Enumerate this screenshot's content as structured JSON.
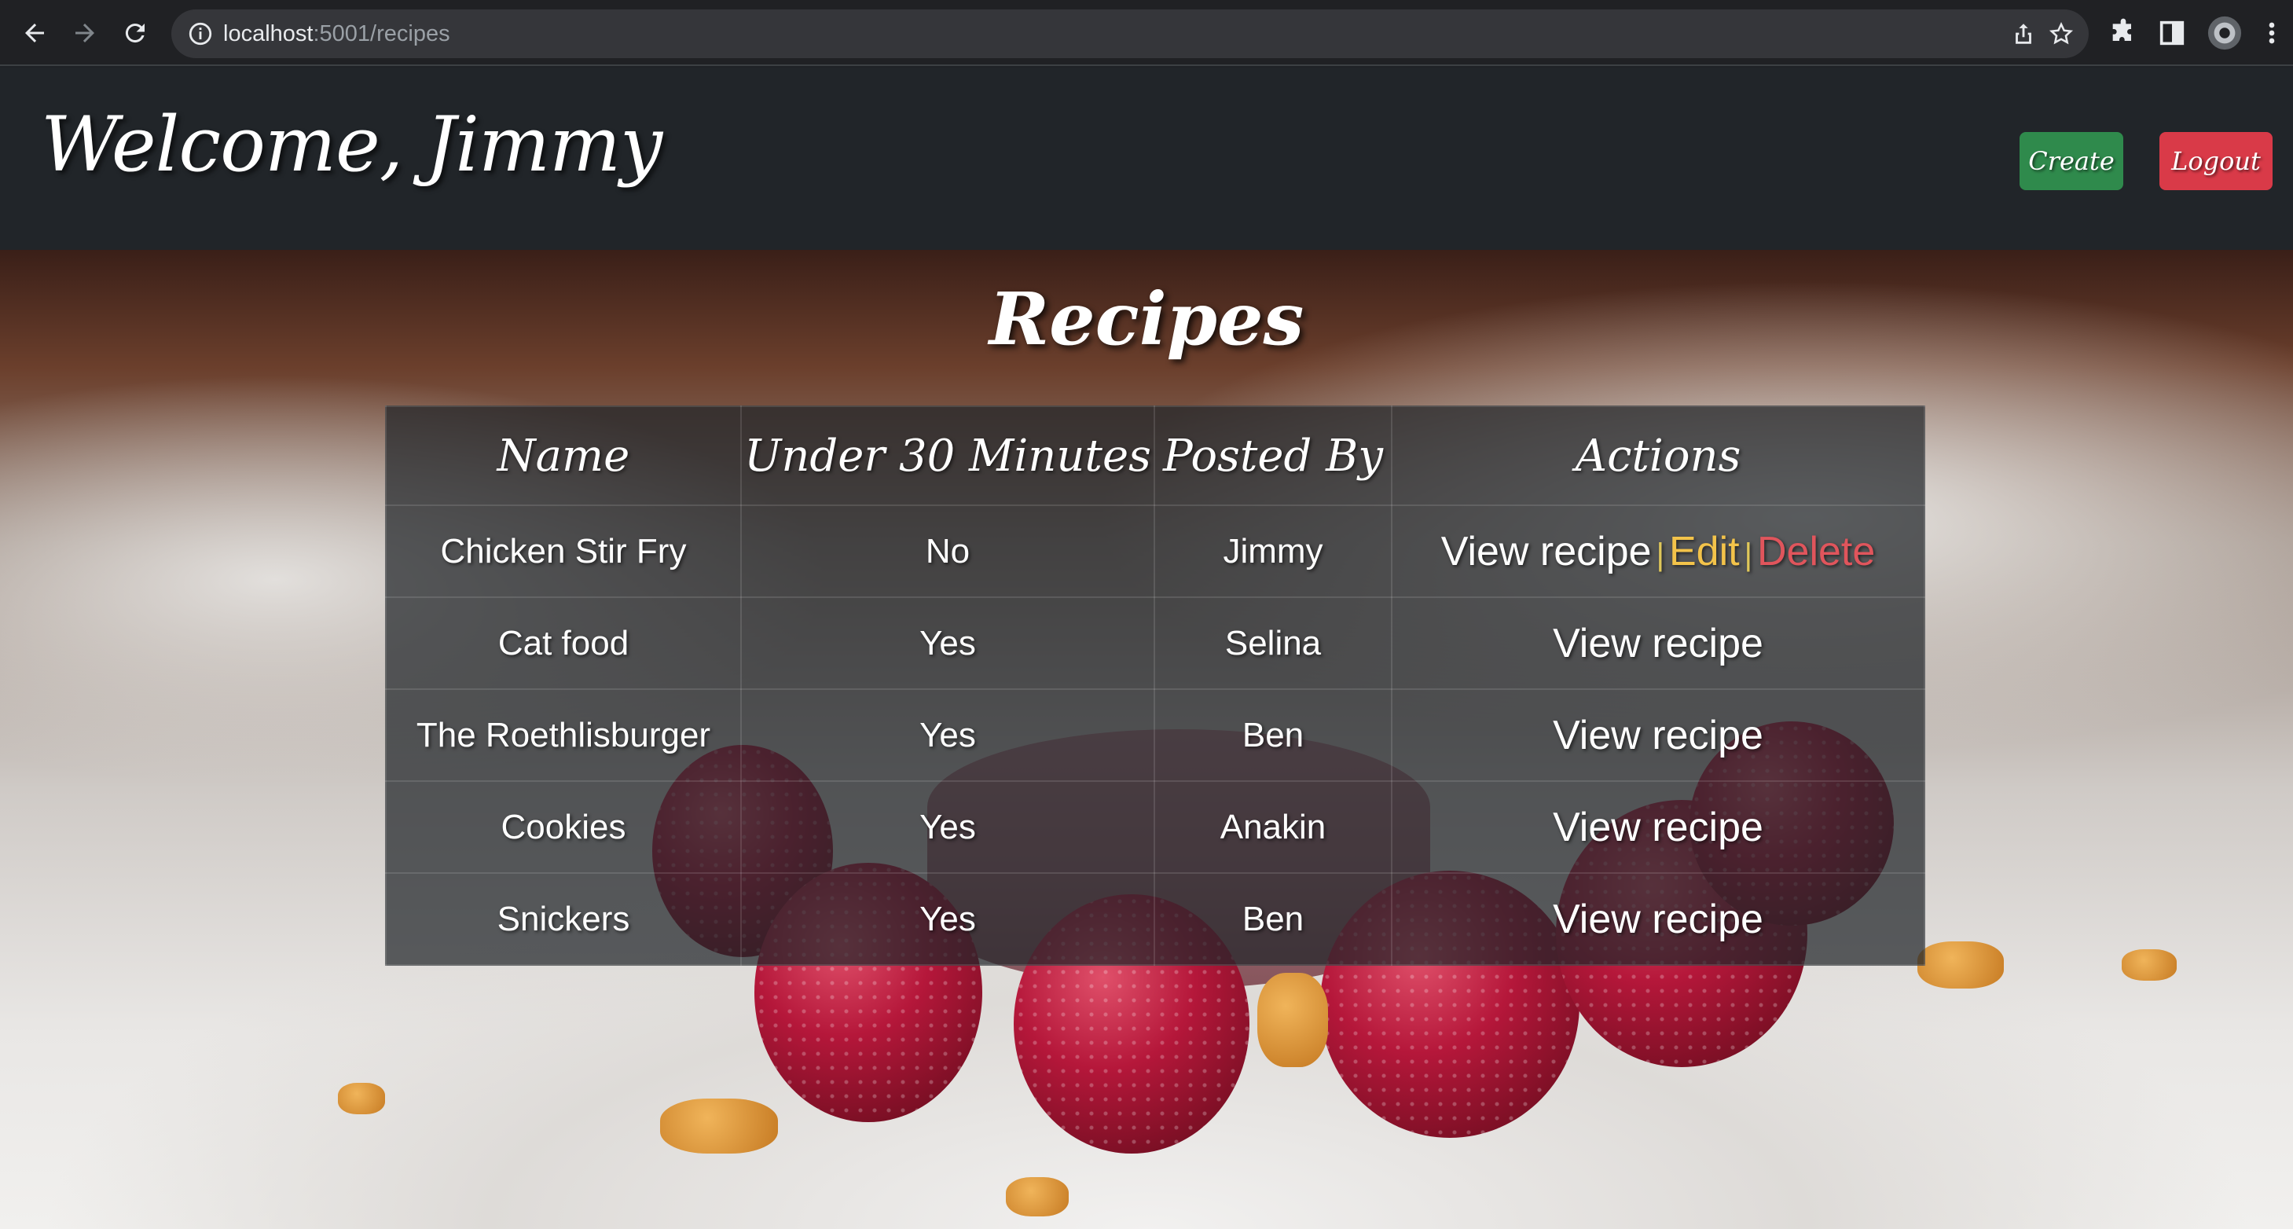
{
  "browser": {
    "url_host": "localhost",
    "url_path": ":5001/recipes",
    "icons": [
      "back-icon",
      "forward-icon",
      "reload-icon",
      "info-icon",
      "share-icon",
      "star-icon",
      "extensions-icon",
      "side-panel-icon",
      "profile-avatar",
      "menu-icon"
    ]
  },
  "header": {
    "welcome": "Welcome, Jimmy",
    "create_label": "Create",
    "logout_label": "Logout"
  },
  "page": {
    "title": "Recipes"
  },
  "table": {
    "columns": [
      "Name",
      "Under 30 Minutes",
      "Posted By",
      "Actions"
    ],
    "rows": [
      {
        "name": "Chicken Stir Fry",
        "under30": "No",
        "posted_by": "Jimmy",
        "view": "View recipe",
        "edit": "Edit",
        "delete": "Delete"
      },
      {
        "name": "Cat food",
        "under30": "Yes",
        "posted_by": "Selina",
        "view": "View recipe"
      },
      {
        "name": "The Roethlisburger",
        "under30": "Yes",
        "posted_by": "Ben",
        "view": "View recipe"
      },
      {
        "name": "Cookies",
        "under30": "Yes",
        "posted_by": "Anakin",
        "view": "View recipe"
      },
      {
        "name": "Snickers",
        "under30": "Yes",
        "posted_by": "Ben",
        "view": "View recipe"
      }
    ],
    "action_separator": "|"
  },
  "colors": {
    "create_button": "#2f8a4c",
    "logout_button": "#d93a48",
    "edit_link": "#f3c34a",
    "delete_link": "#e0555c"
  }
}
